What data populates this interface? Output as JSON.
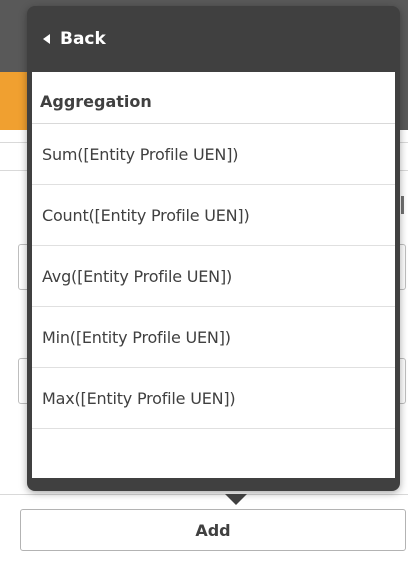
{
  "popup": {
    "back_label": "Back",
    "section_title": "Aggregation",
    "items": [
      {
        "label": "Sum([Entity Profile UEN])"
      },
      {
        "label": "Count([Entity Profile UEN])"
      },
      {
        "label": "Avg([Entity Profile UEN])"
      },
      {
        "label": "Min([Entity Profile UEN])"
      },
      {
        "label": "Max([Entity Profile UEN])"
      }
    ]
  },
  "footer": {
    "add_label": "Add"
  },
  "colors": {
    "popup_bg": "#404040",
    "accent_orange": "#f0a030",
    "text": "#404040"
  }
}
